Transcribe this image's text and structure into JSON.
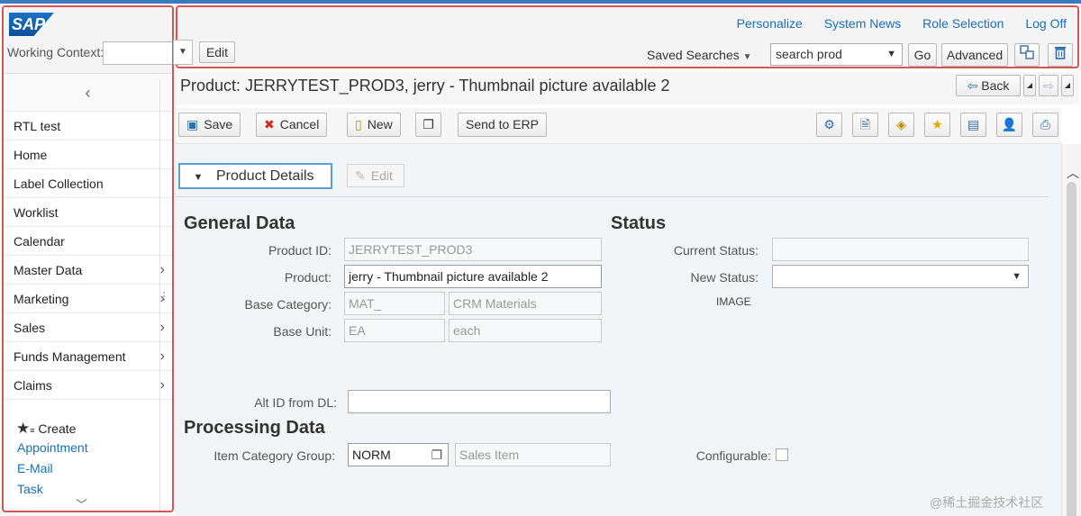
{
  "left": {
    "logo": "SAP",
    "working_context_label": "Working Context:",
    "collapse_icon": "‹",
    "nav": [
      {
        "label": "RTL test",
        "chevron": false
      },
      {
        "label": "Home",
        "chevron": false
      },
      {
        "label": "Label Collection",
        "chevron": false
      },
      {
        "label": "Worklist",
        "chevron": false
      },
      {
        "label": "Calendar",
        "chevron": false
      },
      {
        "label": "Master Data",
        "chevron": true
      },
      {
        "label": "Marketing",
        "chevron": true
      },
      {
        "label": "Sales",
        "chevron": true
      },
      {
        "label": "Funds Management",
        "chevron": true
      },
      {
        "label": "Claims",
        "chevron": true
      }
    ],
    "create_label": "Create",
    "create_links": [
      "Appointment",
      "E-Mail",
      "Task"
    ]
  },
  "header": {
    "links": [
      "Personalize",
      "System News",
      "Role Selection",
      "Log Off"
    ],
    "edit_label": "Edit",
    "saved_searches_label": "Saved Searches",
    "search_value": "search prod",
    "go_label": "Go",
    "advanced_label": "Advanced"
  },
  "titlebar": {
    "title": "Product: JERRYTEST_PROD3, jerry - Thumbnail picture available 2",
    "back_label": "Back"
  },
  "toolbar": {
    "save": "Save",
    "cancel": "Cancel",
    "new": "New",
    "send_to_erp": "Send to ERP"
  },
  "content": {
    "section_label": "Product Details",
    "section_edit": "Edit",
    "general_data_heading": "General Data",
    "status_heading": "Status",
    "processing_heading": "Processing Data",
    "fields": {
      "product_id_label": "Product ID:",
      "product_id_value": "JERRYTEST_PROD3",
      "product_label": "Product:",
      "product_value": "jerry - Thumbnail picture available 2",
      "base_category_label": "Base Category:",
      "base_category_code": "MAT_",
      "base_category_desc": "CRM Materials",
      "base_unit_label": "Base Unit:",
      "base_unit_code": "EA",
      "base_unit_desc": "each",
      "alt_id_label": "Alt ID from DL:",
      "alt_id_value": "",
      "current_status_label": "Current Status:",
      "current_status_value": "",
      "new_status_label": "New Status:",
      "new_status_value": "",
      "image_label": "IMAGE",
      "item_cat_label": "Item Category Group:",
      "item_cat_code": "NORM",
      "item_cat_desc": "Sales Item",
      "configurable_label": "Configurable:"
    }
  },
  "watermark": "@稀土掘金技术社区"
}
